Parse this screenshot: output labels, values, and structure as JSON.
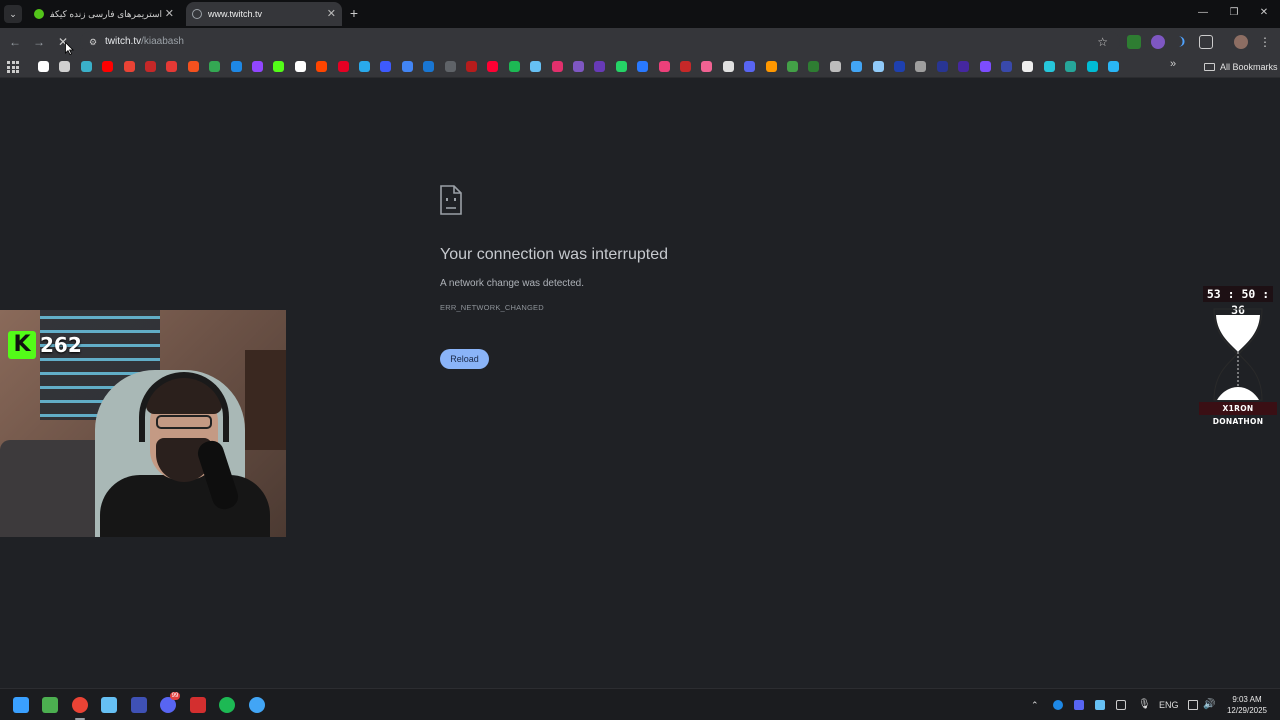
{
  "tabs": [
    {
      "title": "استریمرهای فارسی زنده کیکفا و تی",
      "active": false,
      "favicon_color": "#53c41a"
    },
    {
      "title": "www.twitch.tv",
      "active": true,
      "favicon_color": "#9aa0a6"
    }
  ],
  "address_bar": {
    "host": "twitch.tv",
    "path": "/kiaabash"
  },
  "bookmarks_bar": {
    "all_bookmarks_label": "All Bookmarks",
    "favicons": [
      {
        "icon": "google-icon",
        "color": "#ffffff"
      },
      {
        "icon": "chatgpt-icon",
        "color": "#d0d0d0"
      },
      {
        "icon": "edge-icon",
        "color": "#3ab0c9"
      },
      {
        "icon": "youtube-icon",
        "color": "#ff0000"
      },
      {
        "icon": "gmail-icon",
        "color": "#ea4335"
      },
      {
        "icon": "red-app-icon",
        "color": "#c62828"
      },
      {
        "icon": "red-circle-icon",
        "color": "#e53935"
      },
      {
        "icon": "red-lines-icon",
        "color": "#f4511e"
      },
      {
        "icon": "drive-icon",
        "color": "#34a853"
      },
      {
        "icon": "blue-app-icon",
        "color": "#1e88e5"
      },
      {
        "icon": "twitch-icon",
        "color": "#9146ff"
      },
      {
        "icon": "kick-icon",
        "color": "#53fc18"
      },
      {
        "icon": "x-icon",
        "color": "#ffffff"
      },
      {
        "icon": "reddit-icon",
        "color": "#ff4500"
      },
      {
        "icon": "pinterest-icon",
        "color": "#e60023"
      },
      {
        "icon": "telegram-icon",
        "color": "#29a9eb"
      },
      {
        "icon": "anchor-icon",
        "color": "#3d5afe"
      },
      {
        "icon": "translate-icon",
        "color": "#4285f4"
      },
      {
        "icon": "blue-square-icon",
        "color": "#1976d2"
      },
      {
        "icon": "gray-square-icon",
        "color": "#5f6368"
      },
      {
        "icon": "dark-red-icon",
        "color": "#b71c1c"
      },
      {
        "icon": "youtube-music-icon",
        "color": "#ff0033"
      },
      {
        "icon": "spotify-icon",
        "color": "#1db954"
      },
      {
        "icon": "steam-icon",
        "color": "#66c0f4"
      },
      {
        "icon": "instagram-icon",
        "color": "#e1306c"
      },
      {
        "icon": "purple-icon",
        "color": "#7e57c2"
      },
      {
        "icon": "r-icon",
        "color": "#673ab7"
      },
      {
        "icon": "whatsapp-icon",
        "color": "#25d366"
      },
      {
        "icon": "blue-feather-icon",
        "color": "#2979ff"
      },
      {
        "icon": "pink-icon",
        "color": "#ec407a"
      },
      {
        "icon": "red-bar-icon",
        "color": "#c62828"
      },
      {
        "icon": "pink-grid-icon",
        "color": "#f06292"
      },
      {
        "icon": "ghost-icon",
        "color": "#e0e0e0"
      },
      {
        "icon": "discord-icon",
        "color": "#5865f2"
      },
      {
        "icon": "orange-b-icon",
        "color": "#ff9800"
      },
      {
        "icon": "green-plus-icon",
        "color": "#43a047"
      },
      {
        "icon": "green-plus-2-icon",
        "color": "#2e7d32"
      },
      {
        "icon": "globe-icon",
        "color": "#bdbdbd"
      },
      {
        "icon": "infinity-icon",
        "color": "#42a5f5"
      },
      {
        "icon": "triangle-icon",
        "color": "#90caf9"
      },
      {
        "icon": "blue-bar-icon",
        "color": "#1e40af"
      },
      {
        "icon": "circle-icon",
        "color": "#9e9e9e"
      },
      {
        "icon": "blue-leaf-icon",
        "color": "#283593"
      },
      {
        "icon": "purple-circle-icon",
        "color": "#4527a0"
      },
      {
        "icon": "shield-icon",
        "color": "#7c4dff"
      },
      {
        "icon": "play-icon",
        "color": "#3949ab"
      },
      {
        "icon": "tv-icon",
        "color": "#eeeeee"
      },
      {
        "icon": "cross-icon",
        "color": "#26c6da"
      },
      {
        "icon": "green-tree-icon",
        "color": "#26a69a"
      },
      {
        "icon": "target-icon",
        "color": "#00bcd4"
      },
      {
        "icon": "function-icon",
        "color": "#29b6f6"
      }
    ]
  },
  "error_page": {
    "title": "Your connection was interrupted",
    "message": "A network change was detected.",
    "code": "ERR_NETWORK_CHANGED",
    "reload_label": "Reload"
  },
  "overlay": {
    "kick_viewer_count": "262",
    "kick_logo_letter": "K",
    "timer": "53 : 50 : 36",
    "donathon_label": "X1RON DONATHON"
  },
  "taskbar": {
    "apps": [
      {
        "icon": "windows-start-icon",
        "color": "#3aa0ff"
      },
      {
        "icon": "task-manager-icon",
        "color": "#4caf50"
      },
      {
        "icon": "chrome-icon",
        "color": "#ea4335"
      },
      {
        "icon": "steam-icon",
        "color": "#66c0f4"
      },
      {
        "icon": "chart-app-icon",
        "color": "#3f51b5"
      },
      {
        "icon": "discord-icon",
        "color": "#5865f2"
      },
      {
        "icon": "kick-x-icon",
        "color": "#d32f2f"
      },
      {
        "icon": "spotify-icon",
        "color": "#1db954"
      },
      {
        "icon": "browser-globe-icon",
        "color": "#42a5f5"
      }
    ],
    "discord_badge": "99",
    "language": "ENG",
    "time": "9:03 AM",
    "date": "12/29/2025"
  }
}
